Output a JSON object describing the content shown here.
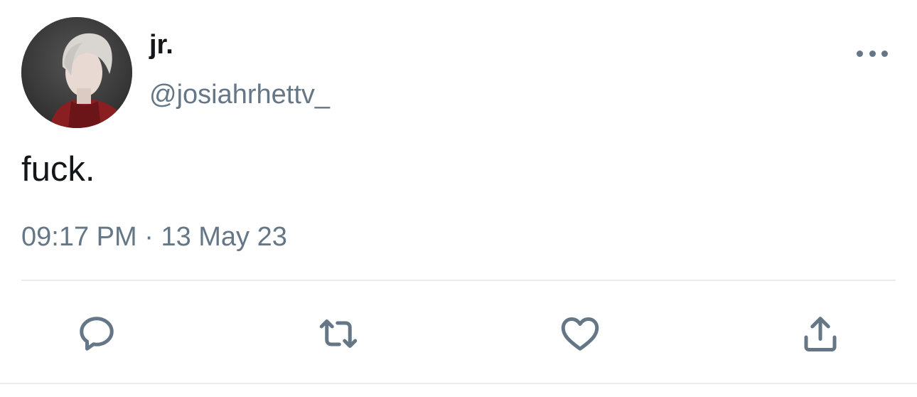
{
  "tweet": {
    "display_name": "jr.",
    "handle": "@josiahrhettv_",
    "text": "fuck.",
    "time": "09:17 PM",
    "separator": "·",
    "date": "13 May 23"
  },
  "icons": {
    "more": "more-horizontal-icon",
    "reply": "reply-icon",
    "retweet": "retweet-icon",
    "like": "heart-icon",
    "share": "share-icon"
  },
  "colors": {
    "primary_text": "#14171a",
    "secondary_text": "#657786",
    "divider": "#e6ecf0",
    "background": "#ffffff"
  }
}
